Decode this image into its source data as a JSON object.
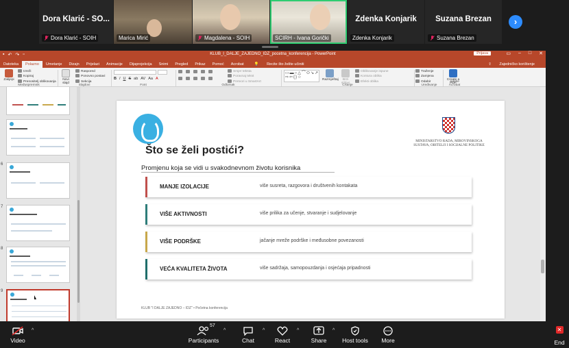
{
  "participants": [
    {
      "name": "Dora Klarić - SO...",
      "label": "Dora Klarić - SOIH",
      "muted": true,
      "video": false
    },
    {
      "name": "",
      "label": "Marica Mirić",
      "muted": false,
      "video": true
    },
    {
      "name": "",
      "label": "Magdalena - SOIH",
      "muted": true,
      "video": true
    },
    {
      "name": "",
      "label": "SCIRH - Ivana Gorički",
      "muted": false,
      "video": true,
      "speaking": true
    },
    {
      "name": "Zdenka Konjarik",
      "label": "Zdenka Konjarik",
      "muted": false,
      "video": false
    },
    {
      "name": "Suzana Brezan",
      "label": "Suzana Brezan",
      "muted": true,
      "video": false
    }
  ],
  "next_icon": "chevron-right-icon",
  "ppt": {
    "title": "KLUB_I_DALJE_ZAJEDNO_IDZ_pocetna_konferencija - PowerPoint",
    "signin": "Prijava",
    "tabs": [
      "Datoteka",
      "Polazno",
      "Umetanje",
      "Dizajn",
      "Prijelazi",
      "Animacije",
      "Dijaprojekcija",
      "Snimi",
      "Pregled",
      "Prikaz",
      "Pomoć",
      "Acrobat"
    ],
    "active_tab": "Polazno",
    "tell_me": "Recite što želite učiniti",
    "share": "Zajedničko korištenje",
    "ribbon": {
      "clipboard": {
        "paste": "Zalijepi",
        "cut": "Izreži",
        "copy": "Kopiraj",
        "format": "Prenositelj oblikovanja",
        "group": "Međuspremnik"
      },
      "slides": {
        "new": "Novi slajd",
        "layout": "Raspored",
        "reset": "Ponovno postavi",
        "section": "Sekcija",
        "group": "Slajdovi"
      },
      "font": {
        "group": "Font",
        "buttons": [
          "B",
          "I",
          "U",
          "S",
          "ab",
          "AV",
          "Aa",
          "A"
        ]
      },
      "paragraph": {
        "group": "Odlomak",
        "direction": "Smjer teksta",
        "align": "Poravnaj tekst",
        "smartart": "Pretvori u SmartArt"
      },
      "drawing": {
        "arrange": "Razmještaj",
        "styles": "Brzi stilovi",
        "fill": "Oblikovanje ispune",
        "outline": "Kontura oblika",
        "effects": "Efekti oblika",
        "group": "Crtanje"
      },
      "editing": {
        "find": "Traženje",
        "replace": "Zamjena",
        "select": "Odabir",
        "group": "Uređivanje"
      },
      "acrobat": {
        "create": "Create a PDF",
        "group": "Adobe Acrobat"
      }
    },
    "thumbnail_numbers": [
      "",
      "",
      "6",
      "7",
      "8",
      "9"
    ]
  },
  "slide": {
    "ministry": "MINISTARSTVO RADA, MIROVINSKOGA SUSTAVA, OBITELJI I SOCIJALNE POLITIKE",
    "title": "Što se želi postići?",
    "subtitle": "Promjenu koja se vidi u svakodnevnom životu korisnika",
    "cards": [
      {
        "title": "MANJE IZOLACIJE",
        "desc": "više susreta, razgovora i društvenih kontakata",
        "color": "#c0504d"
      },
      {
        "title": "VIŠE AKTIVNOSTI",
        "desc": "više prilika za učenje, stvaranje i sudjelovanje",
        "color": "#2e7d7a"
      },
      {
        "title": "VIŠE PODRŠKE",
        "desc": "jačanje mreže podrške i međusobne povezanosti",
        "color": "#c8a84b"
      },
      {
        "title": "VEĆA KVALITETA ŽIVOTA",
        "desc": "više sadržaja, samopouzdanja i osjećaja pripadnosti",
        "color": "#1f6e6b"
      }
    ],
    "footer": "KLUB \"I DALJE ZAJEDNO – IDZ\" • Početna konferencija"
  },
  "toolbar": {
    "video": "Video",
    "participants": "Participants",
    "participants_count": "57",
    "chat": "Chat",
    "react": "React",
    "share": "Share",
    "host_tools": "Host tools",
    "more": "More",
    "end": "End"
  }
}
